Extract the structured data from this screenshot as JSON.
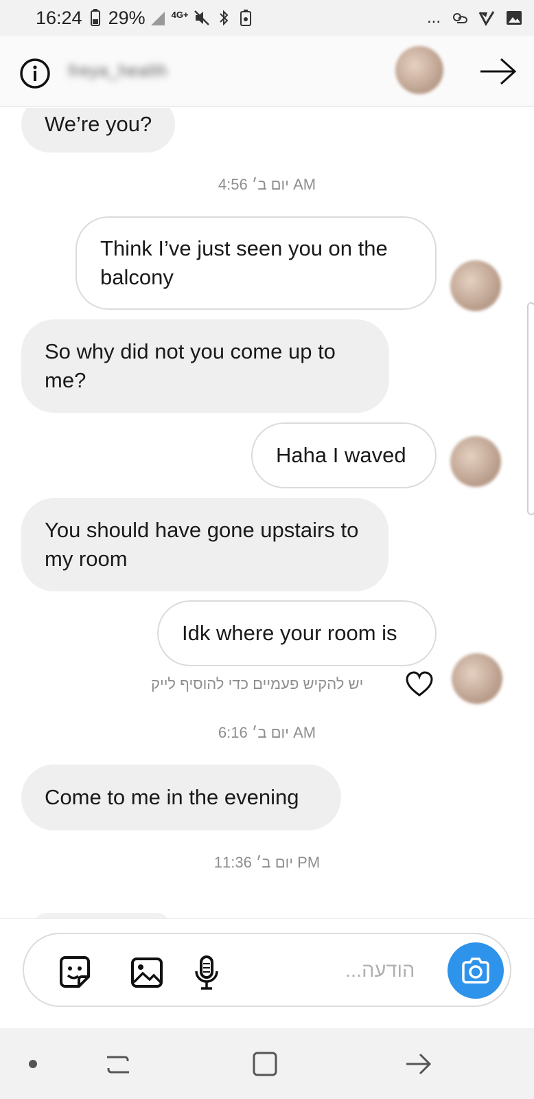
{
  "status_bar": {
    "time": "16:24",
    "battery": "29%",
    "network": "4G+",
    "more": "...",
    "icons": [
      "battery-icon",
      "signal-icon",
      "network-4g-icon",
      "mute-icon",
      "bluetooth-icon",
      "storage-icon",
      "weather-icon",
      "checkbox-icon",
      "gallery-icon"
    ]
  },
  "header": {
    "username": "freya_health"
  },
  "messages": [
    {
      "type": "incoming",
      "text": "We’re you?"
    },
    {
      "type": "timestamp",
      "text": "יום ב׳ 4:56 AM"
    },
    {
      "type": "outgoing",
      "text": "Think I’ve just seen you on the balcony"
    },
    {
      "type": "incoming",
      "text": "So why did not you come up to me?"
    },
    {
      "type": "outgoing",
      "text": "Haha I waved"
    },
    {
      "type": "incoming",
      "text": "You should have gone upstairs to my room"
    },
    {
      "type": "outgoing",
      "text": "Idk where your room is"
    },
    {
      "type": "hint",
      "text": "יש להקיש פעמיים כדי להוסיף לייק"
    },
    {
      "type": "timestamp",
      "text": "יום ב׳ 6:16 AM"
    },
    {
      "type": "incoming",
      "text": "Come to me in the evening"
    },
    {
      "type": "timestamp",
      "text": "יום ב׳ 11:36 PM"
    }
  ],
  "composer": {
    "placeholder": "הודעה...",
    "icons": [
      "sticker-icon",
      "gallery-icon",
      "microphone-icon",
      "camera-icon"
    ]
  },
  "nav_bar": {
    "icons": [
      "dot-icon",
      "recents-icon",
      "home-icon",
      "back-icon"
    ]
  },
  "colors": {
    "camera_button": "#2e93ea",
    "incoming_bubble": "#efefef",
    "outgoing_border": "#dbdbdb",
    "muted_text": "#8e8e8e"
  }
}
